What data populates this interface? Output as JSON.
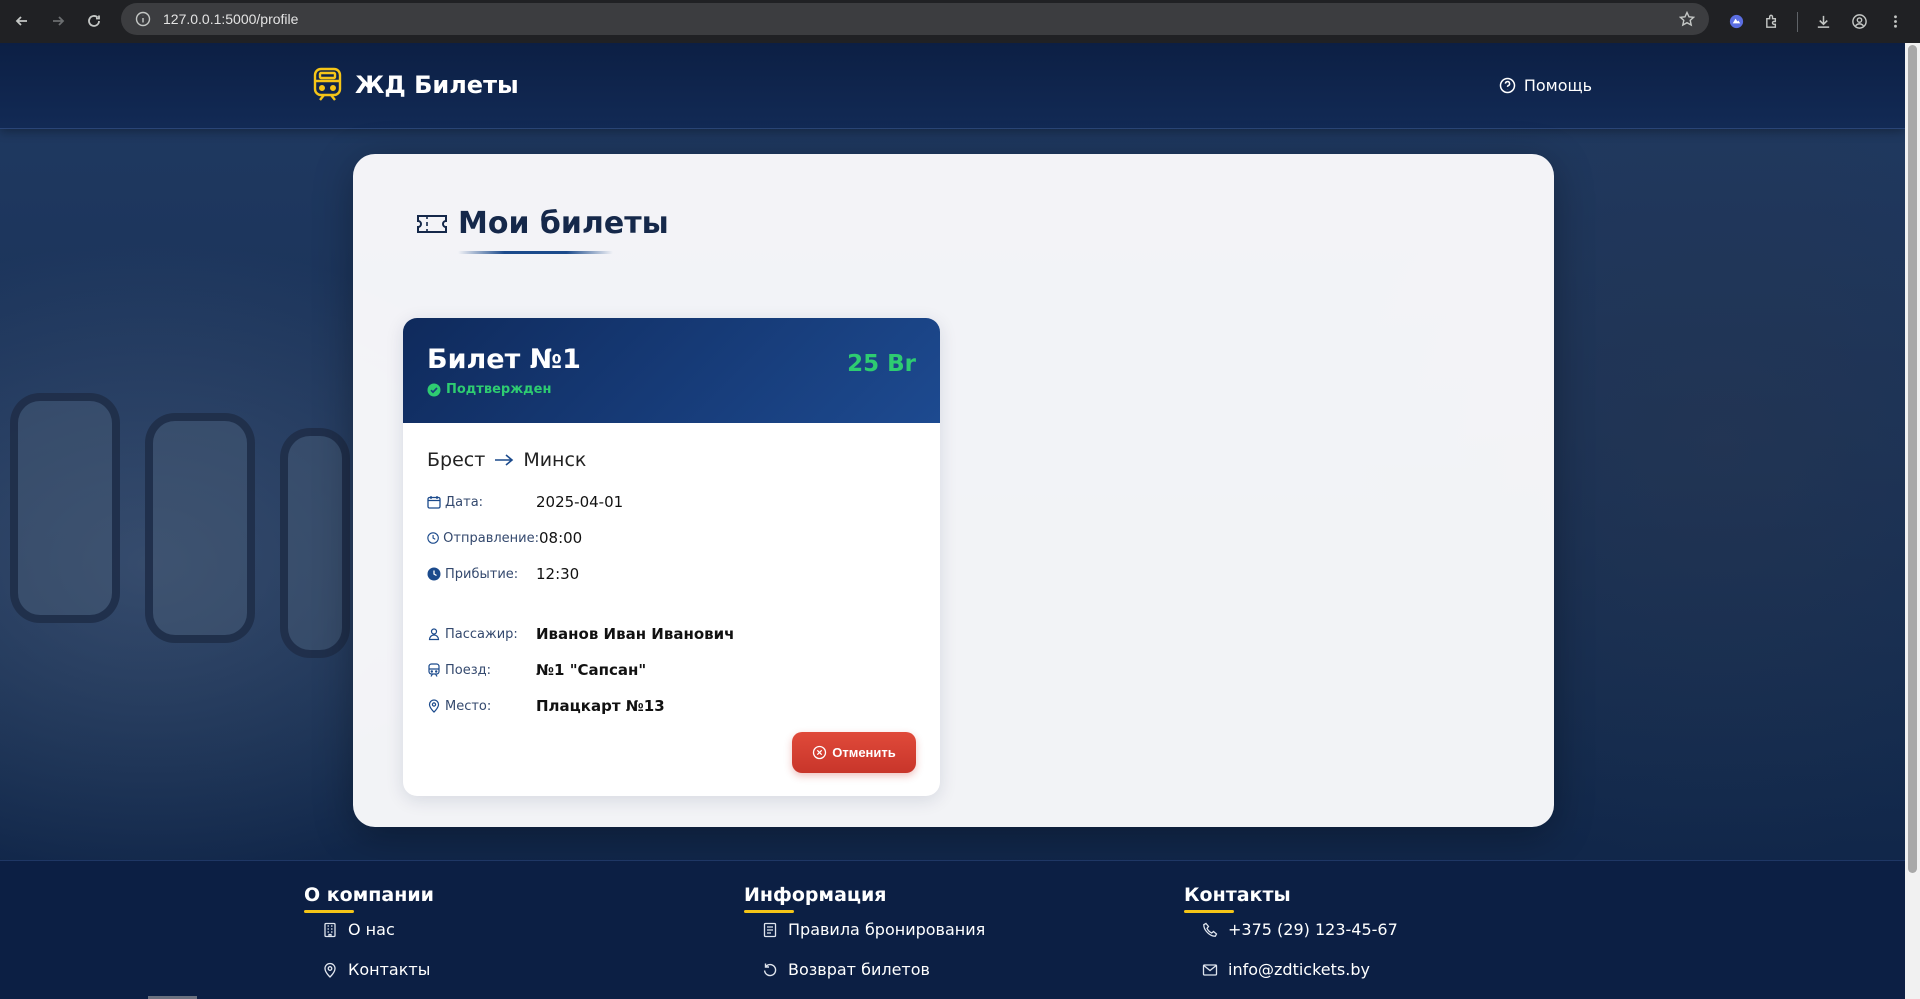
{
  "browser": {
    "url": "127.0.0.1:5000/profile"
  },
  "header": {
    "brand": "ЖД Билеты",
    "help": "Помощь"
  },
  "page": {
    "title": "Мои билеты"
  },
  "ticket": {
    "number": "Билет №1",
    "status": "Подтвержден",
    "price": "25 Br",
    "from": "Брест",
    "to": "Минск",
    "date_label": "Дата:",
    "date": "2025-04-01",
    "departure_label": "Отправление:",
    "departure": "08:00",
    "arrival_label": "Прибытие:",
    "arrival": "12:30",
    "passenger_label": "Пассажир:",
    "passenger": "Иванов Иван Иванович",
    "train_label": "Поезд:",
    "train": "№1 \"Сапсан\"",
    "seat_label": "Место:",
    "seat": "Плацкарт №13",
    "cancel": "Отменить"
  },
  "footer": {
    "columns": [
      {
        "title": "О компании",
        "links": [
          {
            "label": "О нас",
            "icon": "building-icon"
          },
          {
            "label": "Контакты",
            "icon": "location-pin-icon"
          }
        ]
      },
      {
        "title": "Информация",
        "links": [
          {
            "label": "Правила бронирования",
            "icon": "document-icon"
          },
          {
            "label": "Возврат билетов",
            "icon": "refresh-icon"
          }
        ]
      },
      {
        "title": "Контакты",
        "links": [
          {
            "label": "+375 (29) 123-45-67",
            "icon": "phone-icon"
          },
          {
            "label": "info@zdtickets.by",
            "icon": "envelope-icon"
          }
        ]
      }
    ]
  },
  "colors": {
    "navy": "#0c1f44",
    "accent_yellow": "#f5c518",
    "status_green": "#2ecc71",
    "cancel_red": "#d63d2f"
  }
}
